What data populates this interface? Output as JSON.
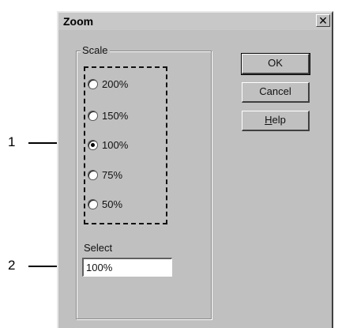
{
  "callouts": [
    {
      "number": "1"
    },
    {
      "number": "2"
    }
  ],
  "dialog": {
    "title": "Zoom",
    "close_glyph": "✕"
  },
  "scale_group": {
    "label": "Scale",
    "options": [
      {
        "label": "200%",
        "checked": false
      },
      {
        "label": "150%",
        "checked": false
      },
      {
        "label": "100%",
        "checked": true
      },
      {
        "label": "75%",
        "checked": false
      },
      {
        "label": "50%",
        "checked": false
      }
    ]
  },
  "select": {
    "label": "Select",
    "value": "100%"
  },
  "buttons": {
    "ok": "OK",
    "cancel": "Cancel",
    "help": "Help"
  }
}
